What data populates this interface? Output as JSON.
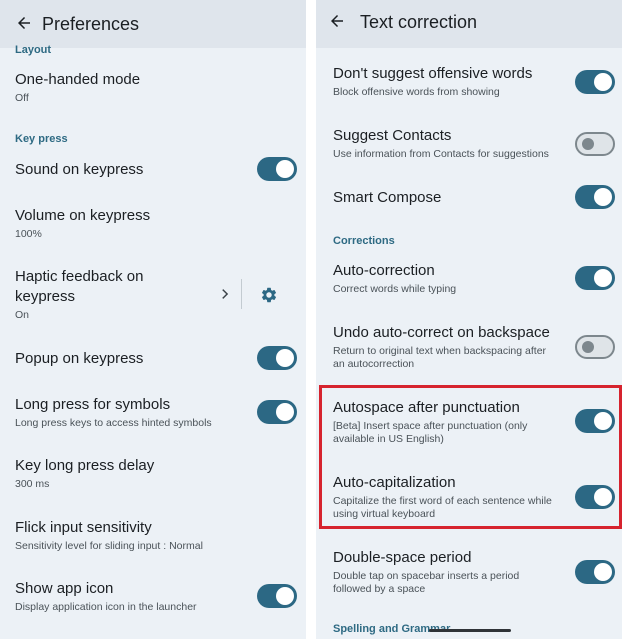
{
  "left": {
    "title": "Preferences",
    "section_layout": "Layout",
    "section_keypress": "Key press",
    "items": [
      {
        "title": "One-handed mode",
        "sub": "Off"
      },
      {
        "title": "Sound on keypress",
        "toggle": "on"
      },
      {
        "title": "Volume on keypress",
        "sub": "100%"
      },
      {
        "title_line1": "Haptic feedback on",
        "title_line2": "keypress",
        "sub": "On"
      },
      {
        "title": "Popup on keypress",
        "toggle": "on"
      },
      {
        "title": "Long press for symbols",
        "sub": "Long press keys to access hinted symbols",
        "toggle": "on"
      },
      {
        "title": "Key long press delay",
        "sub": "300 ms"
      },
      {
        "title": "Flick input sensitivity",
        "sub": "Sensitivity level for sliding input : Normal"
      },
      {
        "title": "Show app icon",
        "sub": "Display application icon in the launcher",
        "toggle": "on"
      }
    ]
  },
  "right": {
    "title": "Text correction",
    "section_corrections": "Corrections",
    "section_spelling": "Spelling and Grammar",
    "items": [
      {
        "title": "Don't suggest offensive words",
        "sub": "Block offensive words from showing",
        "toggle": "on"
      },
      {
        "title": "Suggest Contacts",
        "sub": "Use information from Contacts for suggestions",
        "toggle": "off"
      },
      {
        "title": "Smart Compose",
        "toggle": "on"
      },
      {
        "title": "Auto-correction",
        "sub": "Correct words while typing",
        "toggle": "on"
      },
      {
        "title": "Undo auto-correct on backspace",
        "sub_line1": "Return to original text when backspacing after",
        "sub_line2": "an autocorrection",
        "toggle": "off"
      },
      {
        "title": "Autospace after punctuation",
        "sub_line1": "[Beta] Insert space after punctuation (only",
        "sub_line2": "available in US English)",
        "toggle": "on"
      },
      {
        "title": "Auto-capitalization",
        "sub_line1": "Capitalize the first word of each sentence while",
        "sub_line2": "using virtual keyboard",
        "toggle": "on"
      },
      {
        "title": "Double-space period",
        "sub_line1": "Double tap on spacebar inserts a period",
        "sub_line2": "followed by a space",
        "toggle": "on"
      }
    ]
  },
  "icons": {
    "back": "arrow-back-icon",
    "chevron": "chevron-right-icon",
    "settings": "gear-icon"
  },
  "colors": {
    "accent": "#2c6884",
    "highlight": "#d6232e",
    "background": "#ecf1f6"
  }
}
